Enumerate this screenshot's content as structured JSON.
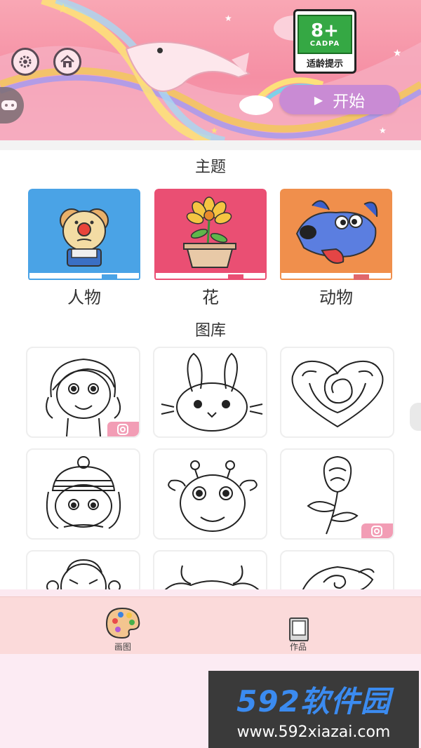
{
  "header": {
    "age_rating": {
      "number": "8+",
      "org": "CADPA",
      "label": "适龄提示"
    },
    "start_button": {
      "label": "开始",
      "icon": "play-icon"
    },
    "settings_icon": "gear-icon",
    "home_icon": "home-icon",
    "side_tab_icon": "gamepad-icon"
  },
  "themes": {
    "title": "主题",
    "items": [
      {
        "label": "人物",
        "color": "#4aa3e6",
        "icon": "clown-icon"
      },
      {
        "label": "花",
        "color": "#ea4f73",
        "icon": "flower-pot-icon"
      },
      {
        "label": "动物",
        "color": "#f08f4c",
        "icon": "dog-icon"
      }
    ]
  },
  "gallery": {
    "title": "图库",
    "items": [
      {
        "subject": "girl-icon",
        "badge": true
      },
      {
        "subject": "rabbit-icon",
        "badge": false
      },
      {
        "subject": "rose-heart-icon",
        "badge": false
      },
      {
        "subject": "girl-hat-icon",
        "badge": false
      },
      {
        "subject": "giraffe-icon",
        "badge": false
      },
      {
        "subject": "rose-icon",
        "badge": true
      },
      {
        "subject": "monkey-icon",
        "badge": false
      },
      {
        "subject": "cow-icon",
        "badge": false
      },
      {
        "subject": "rose-bloom-icon",
        "badge": false
      }
    ]
  },
  "tabbar": {
    "items": [
      {
        "label": "画图",
        "icon": "palette-icon"
      },
      {
        "label": "作品",
        "icon": "book-icon"
      }
    ]
  },
  "watermark": {
    "brand": "592软件园",
    "url": "www.592xiazai.com"
  },
  "colors": {
    "accent": "#c98bd4",
    "header_pink": "#f58fa4",
    "tabbar": "#fbdada"
  }
}
